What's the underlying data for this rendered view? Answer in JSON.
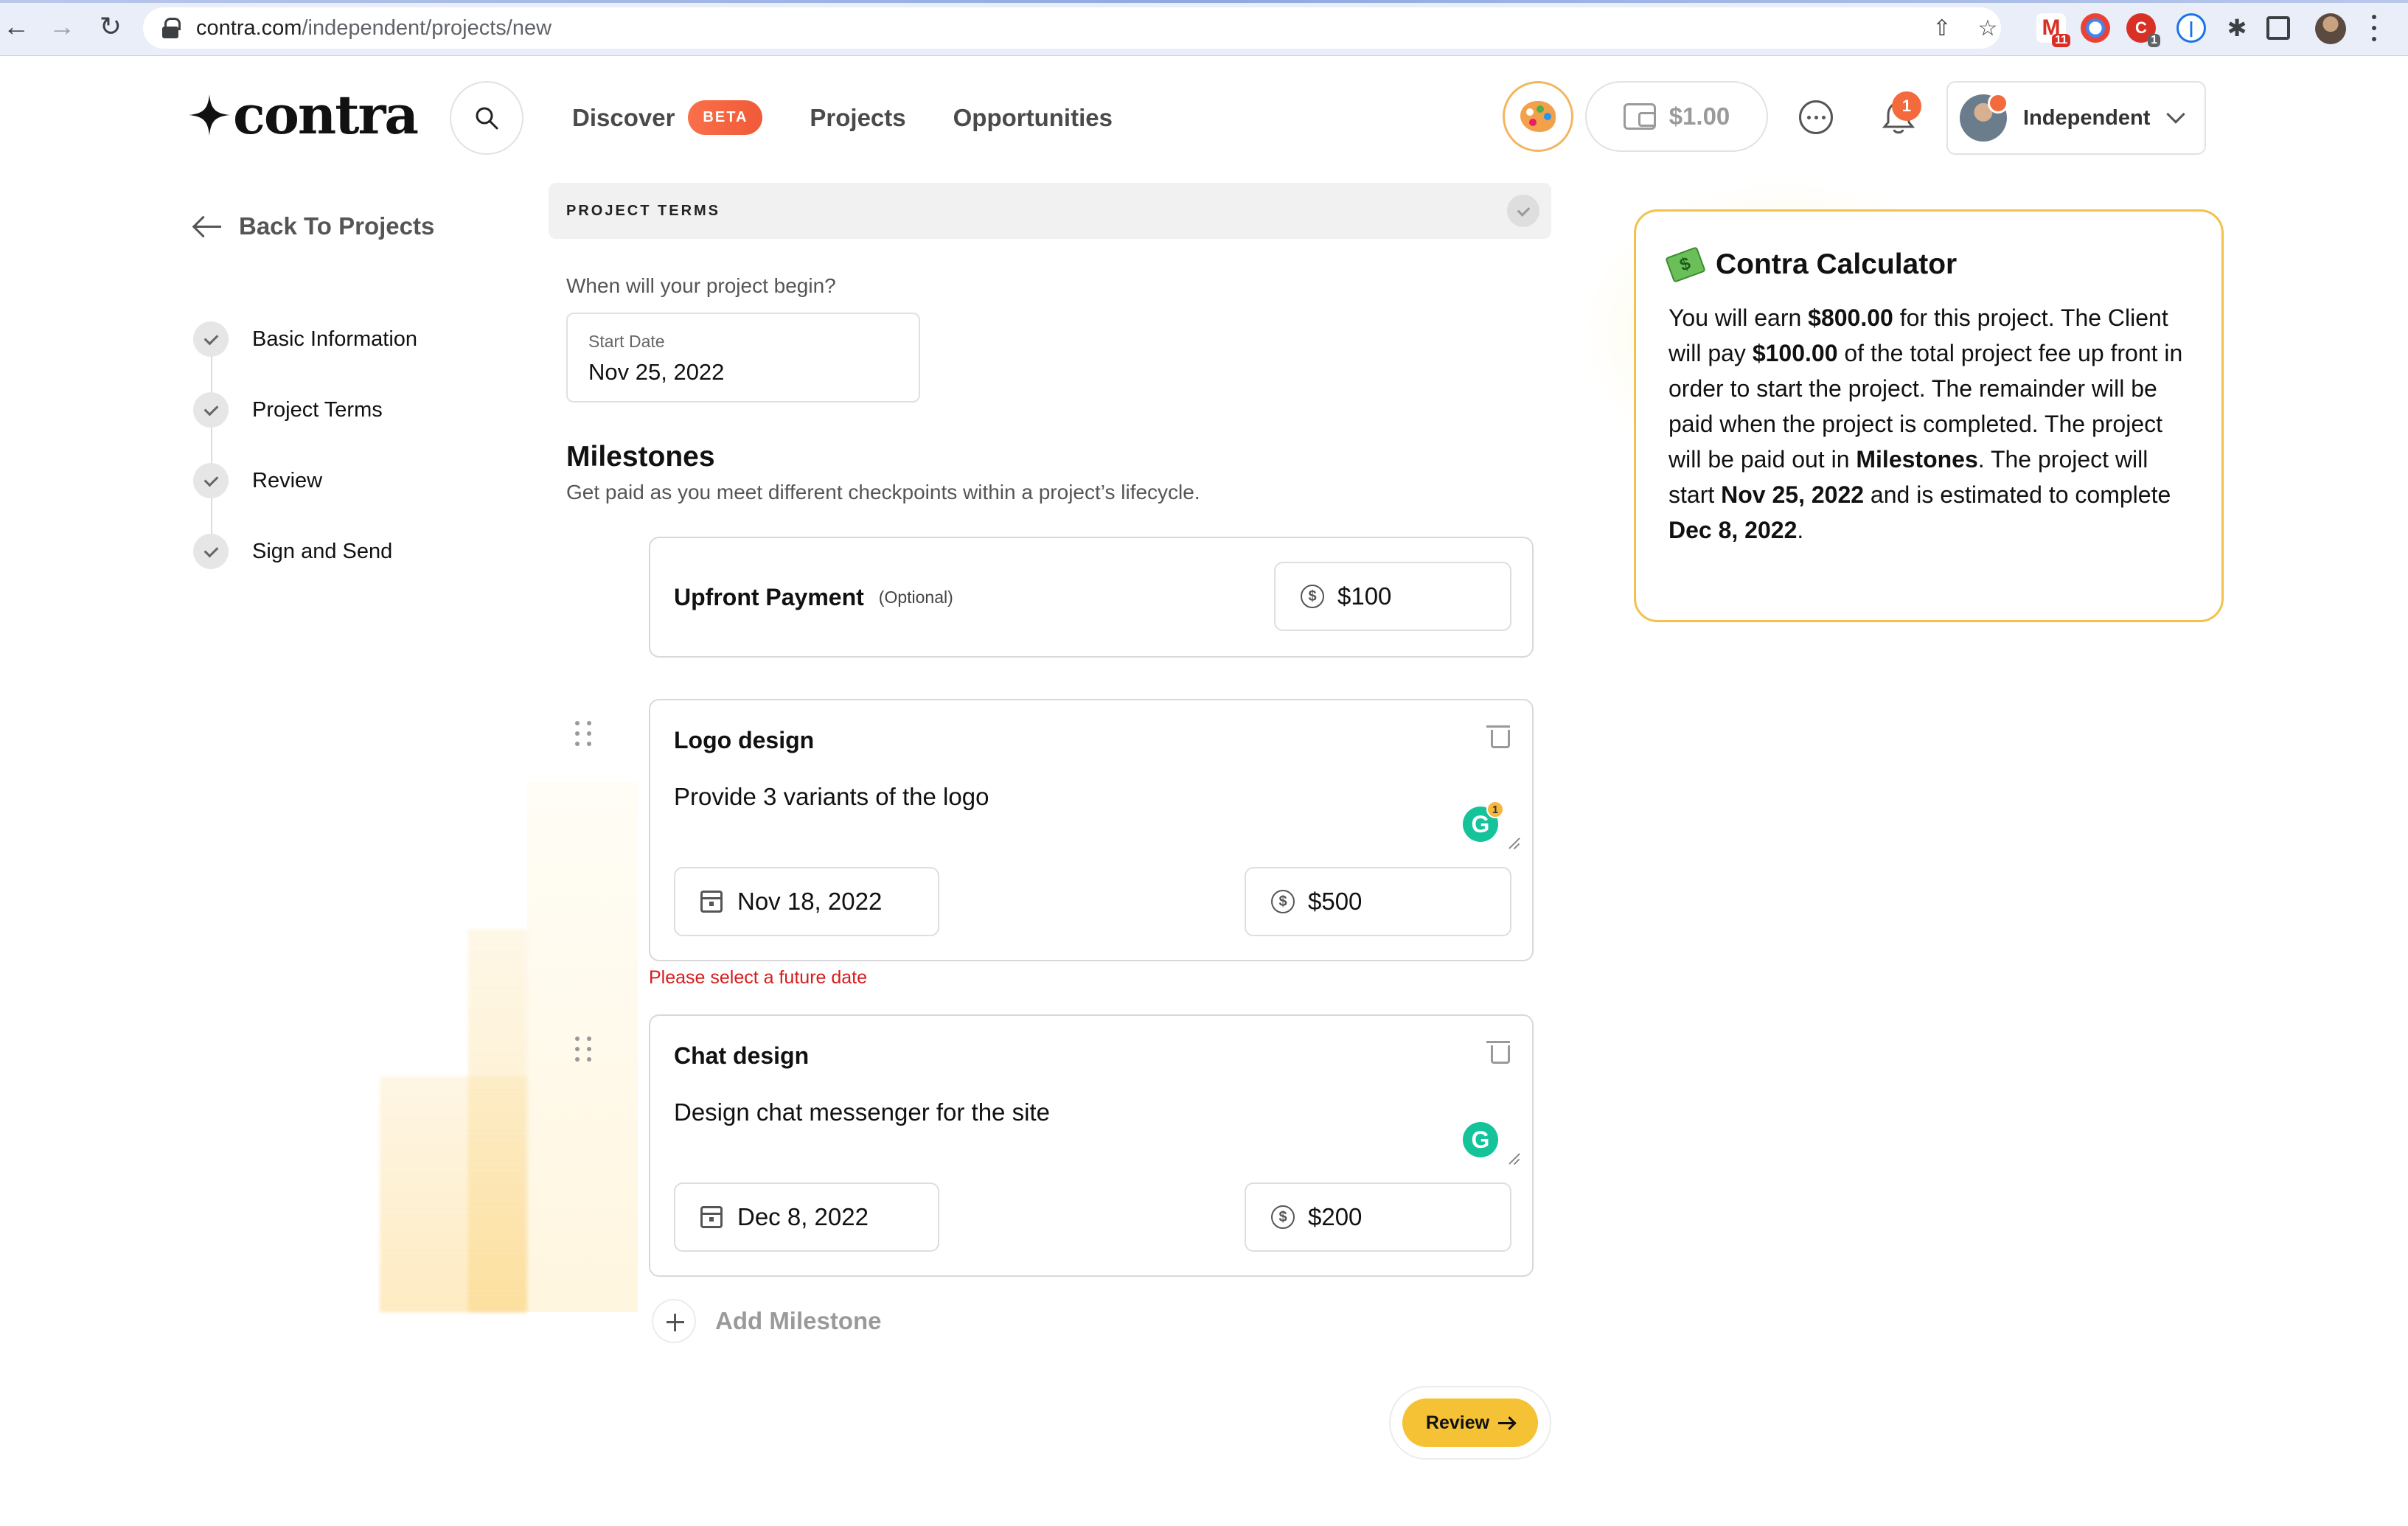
{
  "browser": {
    "url_domain": "contra.com",
    "url_path": "/independent/projects/new",
    "ext_gmail_badge": "11",
    "ext_badge_2": "1"
  },
  "header": {
    "logo_text": "contra",
    "nav": {
      "discover": "Discover",
      "beta_badge": "BETA",
      "projects": "Projects",
      "opportunities": "Opportunities"
    },
    "wallet_amount": "$1.00",
    "notification_count": "1",
    "account_name": "Independent"
  },
  "sidebar": {
    "back_label": "Back To Projects",
    "steps": [
      {
        "label": "Basic Information"
      },
      {
        "label": "Project Terms"
      },
      {
        "label": "Review"
      },
      {
        "label": "Sign and Send"
      }
    ]
  },
  "main": {
    "section_title": "PROJECT TERMS",
    "start_question": "When will your project begin?",
    "start_date_label": "Start Date",
    "start_date_value": "Nov 25, 2022",
    "milestones_title": "Milestones",
    "milestones_subtitle": "Get paid as you meet different checkpoints within a project’s lifecycle.",
    "upfront": {
      "name": "Upfront Payment",
      "optional": "(Optional)",
      "amount": "$100"
    },
    "milestones": [
      {
        "name": "Logo design",
        "description": "Provide 3 variants of the logo",
        "date": "Nov 18, 2022",
        "amount": "$500",
        "grammarly_badge": "1",
        "error": "Please select a future date"
      },
      {
        "name": "Chat design",
        "description": "Design chat messenger for the site",
        "date": "Dec 8, 2022",
        "amount": "$200"
      }
    ],
    "add_milestone_label": "Add Milestone",
    "review_label": "Review"
  },
  "calculator": {
    "title": "Contra Calculator",
    "t1": "You will earn ",
    "earn": "$800.00",
    "t2": " for this project. The Client will pay ",
    "upfront": "$100.00",
    "t3": " of the total project fee up front in order to start the project. The remainder will be paid when the project is completed. The project will be paid out in ",
    "payout": "Milestones",
    "t4": ". The project will start ",
    "start": "Nov 25, 2022",
    "t5": " and is estimated to complete ",
    "end": "Dec 8, 2022",
    "t6": "."
  },
  "colors": {
    "accent_yellow": "#f5c236",
    "beta_orange": "#f05a38",
    "error_red": "#d81b1b",
    "grammarly_green": "#15c39a"
  }
}
